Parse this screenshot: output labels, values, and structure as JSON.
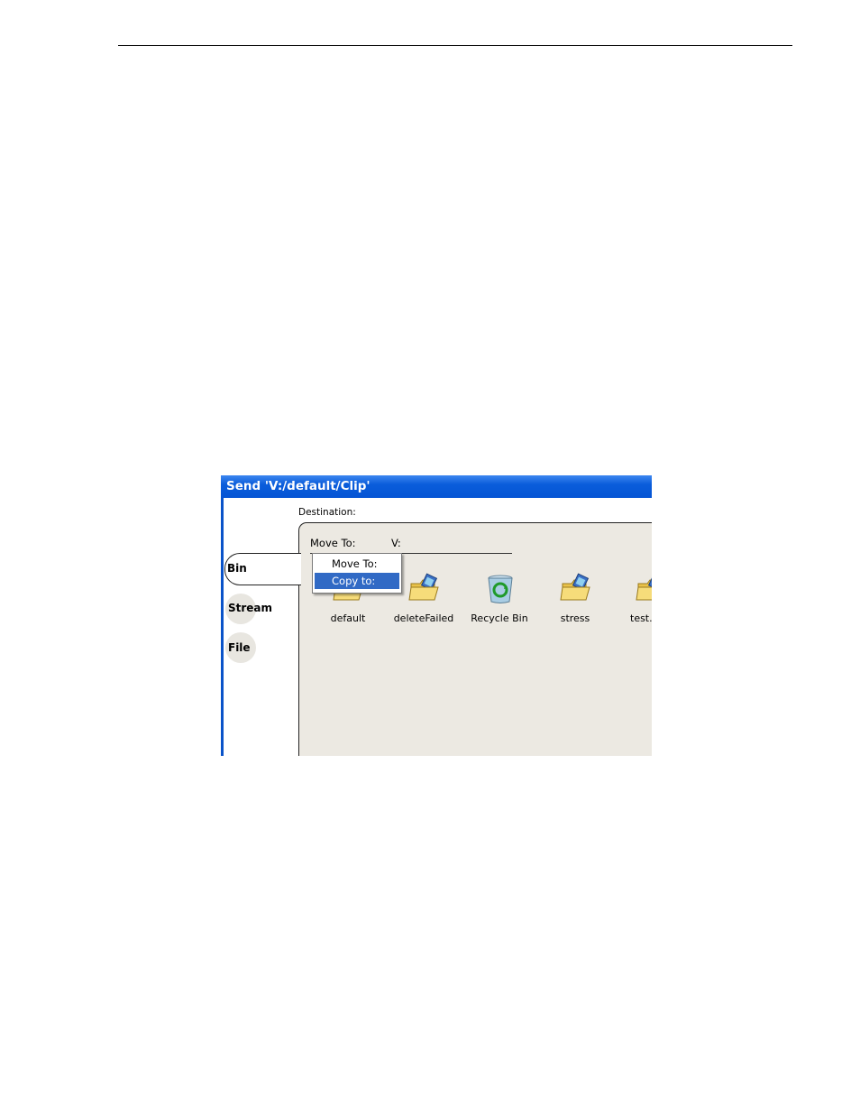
{
  "window": {
    "title": "Send 'V:/default/Clip'"
  },
  "destination_label": "Destination:",
  "tabs": [
    {
      "label": "Bin",
      "selected": true
    },
    {
      "label": "Stream",
      "selected": false
    },
    {
      "label": "File",
      "selected": false
    }
  ],
  "path_row": {
    "action_label": "Move To:",
    "location": "V:"
  },
  "context_menu": {
    "items": [
      {
        "label": "Move To:",
        "highlighted": false
      },
      {
        "label": "Copy to:",
        "highlighted": true
      }
    ],
    "highlight_color": "#316ac5"
  },
  "bins": [
    {
      "label": "default",
      "icon": "folder-icon"
    },
    {
      "label": "deleteFailed",
      "icon": "folder-clip-icon"
    },
    {
      "label": "Recycle Bin",
      "icon": "recycle-bin-icon"
    },
    {
      "label": "stress",
      "icon": "folder-clip-icon"
    },
    {
      "label": "test.c",
      "icon": "folder-clip-icon"
    }
  ],
  "colors": {
    "titlebar": "#0a5ddb",
    "panel_bg": "#ece9e2"
  }
}
